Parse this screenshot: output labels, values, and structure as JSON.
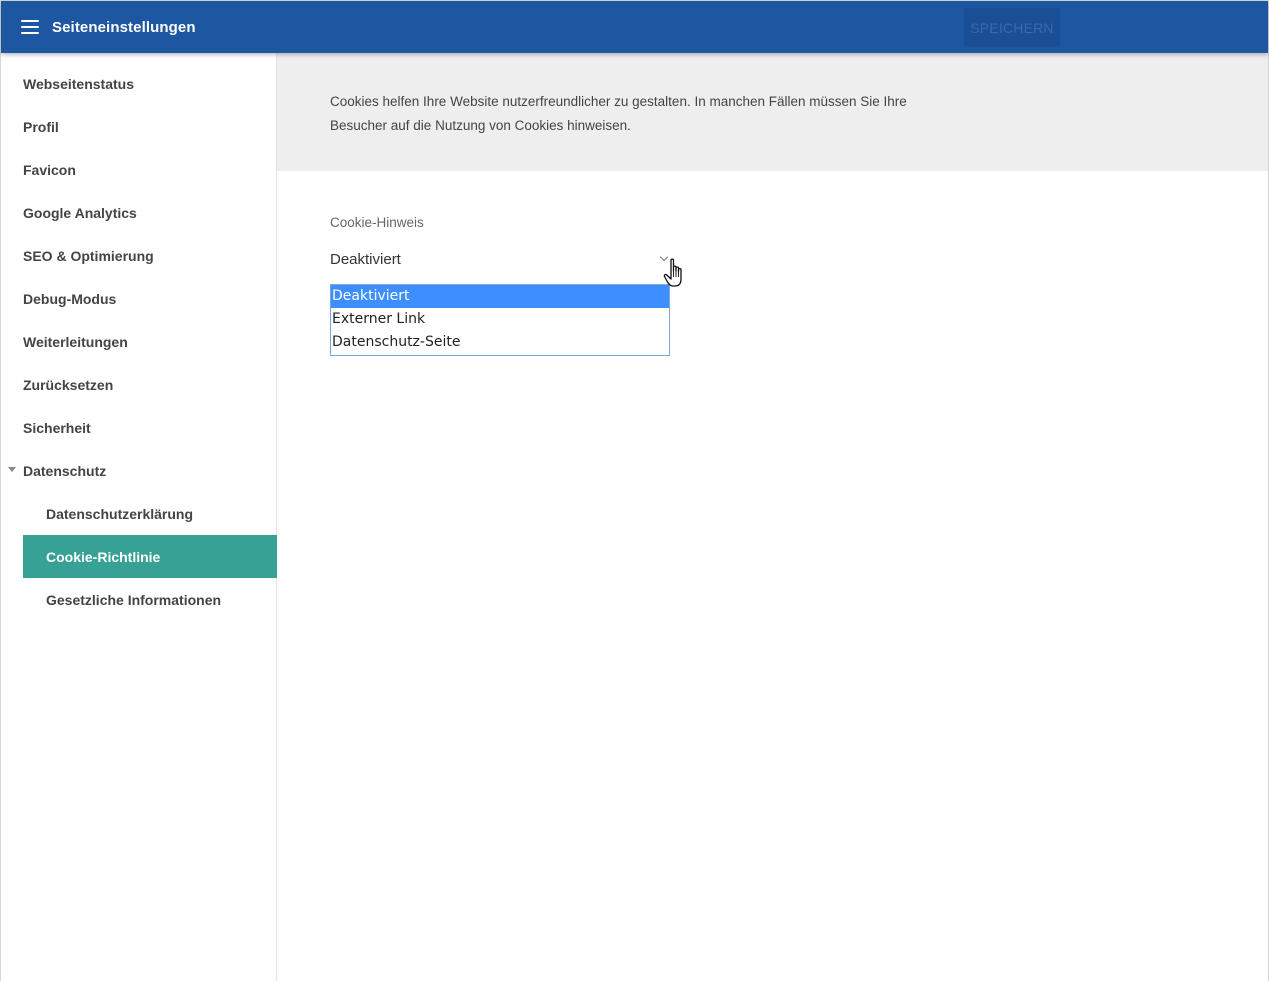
{
  "header": {
    "title": "Seiteneinstellungen",
    "save_label": "SPEICHERN",
    "menu_icon": "hamburger-menu-icon"
  },
  "colors": {
    "header_bg": "#1d56a1",
    "active_item_bg": "#37a196",
    "selected_option_bg": "#3d8fff",
    "info_panel_bg": "#eeeeee"
  },
  "sidebar": {
    "items": [
      {
        "label": "Webseitenstatus"
      },
      {
        "label": "Profil"
      },
      {
        "label": "Favicon"
      },
      {
        "label": "Google Analytics"
      },
      {
        "label": "SEO & Optimierung"
      },
      {
        "label": "Debug-Modus"
      },
      {
        "label": "Weiterleitungen"
      },
      {
        "label": "Zurücksetzen"
      },
      {
        "label": "Sicherheit"
      },
      {
        "label": "Datenschutz",
        "expanded": true
      }
    ],
    "subitems": [
      {
        "label": "Datenschutzerklärung"
      },
      {
        "label": "Cookie-Richtlinie",
        "active": true
      },
      {
        "label": "Gesetzliche Informationen"
      }
    ]
  },
  "main": {
    "info_line1": "Cookies helfen Ihre Website nutzerfreundlicher zu gestalten. In manchen Fällen müssen Sie Ihre",
    "info_line2": "Besucher auf die Nutzung von Cookies hinweisen.",
    "field_label": "Cookie-Hinweis",
    "select_value": "Deaktiviert",
    "options": [
      {
        "label": "Deaktiviert",
        "selected": true
      },
      {
        "label": "Externer Link"
      },
      {
        "label": "Datenschutz-Seite"
      }
    ]
  }
}
